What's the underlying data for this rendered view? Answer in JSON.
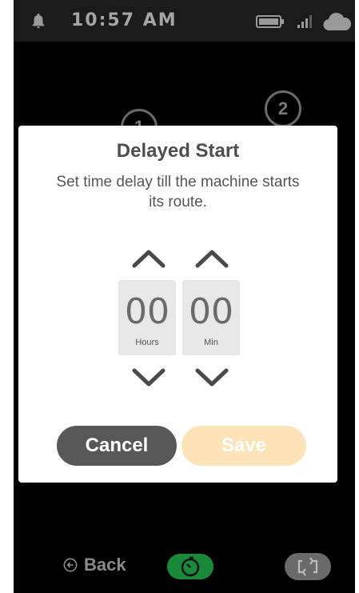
{
  "status_bar": {
    "time": "10:57 AM",
    "icons": [
      "bell-icon",
      "battery-icon",
      "signal-icon",
      "cloud-icon"
    ]
  },
  "background": {
    "steps": [
      "1",
      "2"
    ]
  },
  "modal": {
    "title": "Delayed Start",
    "description": "Set time delay till the machine starts its route.",
    "hours": {
      "value": "00",
      "label": "Hours"
    },
    "minutes": {
      "value": "00",
      "label": "Min"
    },
    "cancel_label": "Cancel",
    "save_label": "Save"
  },
  "bottom_bar": {
    "back_label": "Back"
  },
  "colors": {
    "save_disabled": "#fce4b8",
    "cancel": "#585858",
    "timer_active": "#1a8a3a"
  }
}
